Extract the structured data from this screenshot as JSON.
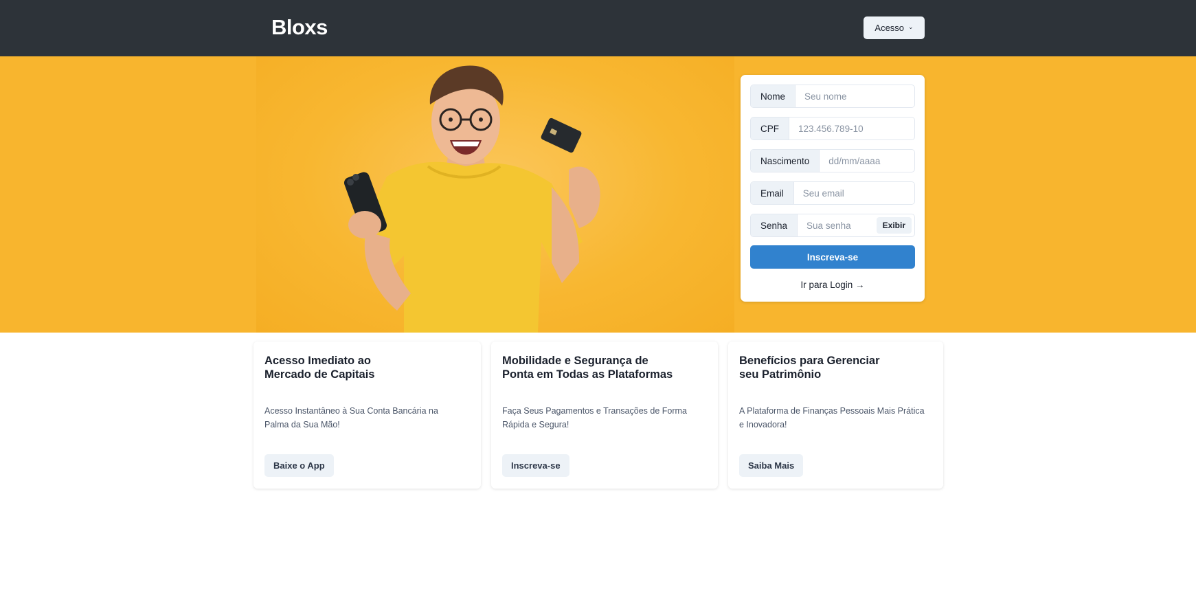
{
  "header": {
    "brand": "Bloxs",
    "access_label": "Acesso"
  },
  "form": {
    "fields": [
      {
        "label": "Nome",
        "placeholder": "Seu nome"
      },
      {
        "label": "CPF",
        "placeholder": "123.456.789-10"
      },
      {
        "label": "Nascimento",
        "placeholder": "dd/mm/aaaa"
      },
      {
        "label": "Email",
        "placeholder": "Seu email"
      },
      {
        "label": "Senha",
        "placeholder": "Sua senha"
      }
    ],
    "show_password_label": "Exibir",
    "submit_label": "Inscreva-se",
    "login_link": "Ir para Login →"
  },
  "cards": [
    {
      "title": "Acesso Imediato ao\nMercado de Capitais",
      "text_line1": "Acesso Instantâneo à Sua Conta Bancária na",
      "text_line2": "Palma da Sua Mão!",
      "button": "Baixe o App"
    },
    {
      "title": "Mobilidade e Segurança de\nPonta em Todas as Plataformas",
      "text_line1": "Faça Seus Pagamentos e Transações de Forma",
      "text_line2": "Rápida e Segura!",
      "button": "Inscreva-se"
    },
    {
      "title": "Benefícios para Gerenciar\nseu Patrimônio",
      "text_line1": "A Plataforma de Finanças Pessoais Mais Prática",
      "text_line2": "e Inovadora!",
      "button": "Saiba Mais"
    }
  ],
  "colors": {
    "header_bg": "#2d3339",
    "hero_bg": "#f8b52e",
    "primary": "#3182ce"
  }
}
